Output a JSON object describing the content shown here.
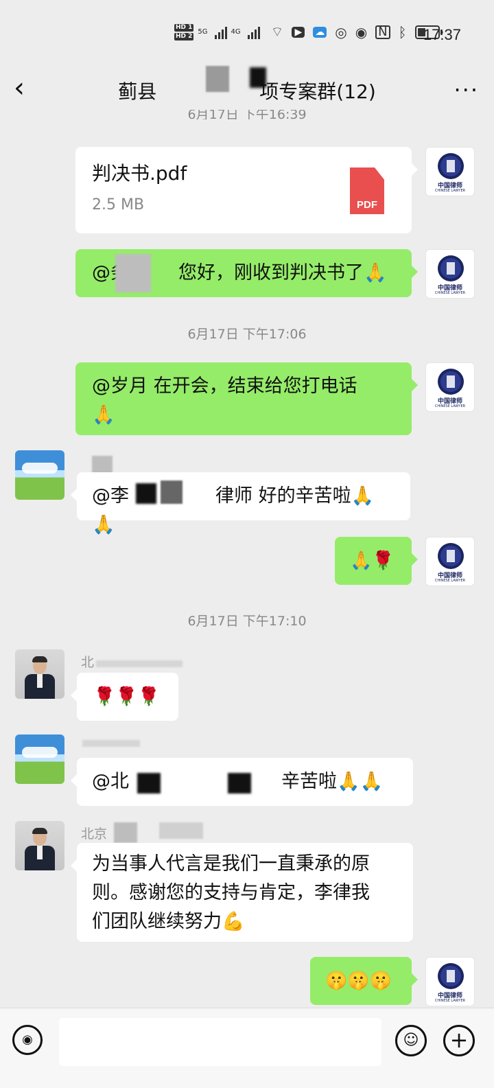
{
  "status_bar": {
    "hd1": "HD 1",
    "hd2": "HD 2",
    "net1": "5G",
    "net2": "4G",
    "time": "17:37",
    "battery_level": 0.35,
    "icons": [
      "wifi-icon",
      "play-icon",
      "cloud-app-icon",
      "audio-icon",
      "eye-icon",
      "nfc-icon",
      "bluetooth-icon",
      "battery-icon"
    ]
  },
  "header": {
    "back_glyph": "‹",
    "title_left": "蓟县",
    "title_right": "项专案群(12)",
    "more_glyph": "···"
  },
  "messages": {
    "ts0": "6月17日 下午16:39",
    "file": {
      "name": "判决书.pdf",
      "size": "2.5 MB",
      "badge": "PDF"
    },
    "m2": {
      "prefix": "@务",
      "text": "您好，刚收到判决书了🙏"
    },
    "ts1": "6月17日 下午17:06",
    "m3": {
      "line1": "@岁月  在开会，结束给您打电话",
      "line2": "🙏"
    },
    "m4": {
      "prefix": "@李",
      "suffix": "律师 好的辛苦啦🙏🙏"
    },
    "m5": {
      "text": "🙏🌹"
    },
    "ts2": "6月17日 下午17:10",
    "m6": {
      "sender": "北",
      "text": "🌹🌹🌹"
    },
    "m7": {
      "prefix": "@北",
      "suffix": "辛苦啦🙏🙏"
    },
    "m8": {
      "sender": "北京",
      "line1": "为当事人代言是我们一直秉承的原",
      "line2": "则。感谢您的支持与肯定，李律我",
      "line3": "们团队继续努力💪"
    },
    "m9": {
      "text": "🤫🤫🤫"
    }
  },
  "avatar_text": {
    "cn": "中国律师",
    "en": "CHINESE LAWYER"
  },
  "input_bar": {
    "voice_glyph": "◉",
    "emoji_glyph": "☺",
    "plus_glyph": "+"
  }
}
